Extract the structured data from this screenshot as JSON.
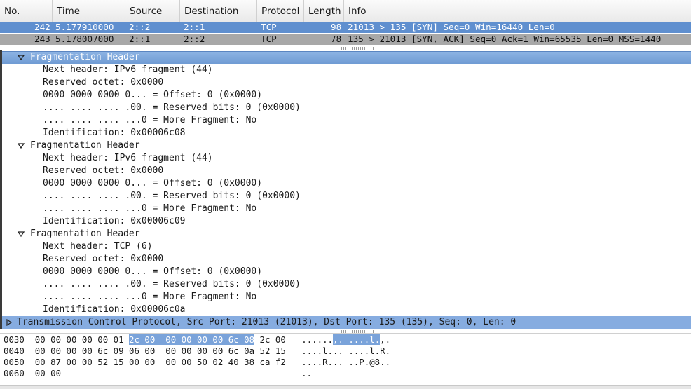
{
  "columns": [
    "No.",
    "Time",
    "Source",
    "Destination",
    "Protocol",
    "Length",
    "Info"
  ],
  "packets": [
    {
      "no": "242",
      "time": "5.177910000",
      "source": "2::2",
      "destination": "2::1",
      "protocol": "TCP",
      "length": "98",
      "info": "21013 > 135 [SYN] Seq=0 Win=16440 Len=0"
    },
    {
      "no": "243",
      "time": "5.178007000",
      "source": "2::1",
      "destination": "2::2",
      "protocol": "TCP",
      "length": "78",
      "info": "135 > 21013 [SYN, ACK] Seq=0 Ack=1 Win=65535 Len=0 MSS=1440"
    }
  ],
  "details": {
    "frag1": {
      "title": "Fragmentation Header",
      "lines": [
        "Next header: IPv6 fragment (44)",
        "Reserved octet: 0x0000",
        "0000 0000 0000 0... = Offset: 0 (0x0000)",
        ".... .... .... .00. = Reserved bits: 0 (0x0000)",
        ".... .... .... ...0 = More Fragment: No",
        "Identification: 0x00006c08"
      ]
    },
    "frag2": {
      "title": "Fragmentation Header",
      "lines": [
        "Next header: IPv6 fragment (44)",
        "Reserved octet: 0x0000",
        "0000 0000 0000 0... = Offset: 0 (0x0000)",
        ".... .... .... .00. = Reserved bits: 0 (0x0000)",
        ".... .... .... ...0 = More Fragment: No",
        "Identification: 0x00006c09"
      ]
    },
    "frag3": {
      "title": "Fragmentation Header",
      "lines": [
        "Next header: TCP (6)",
        "Reserved octet: 0x0000",
        "0000 0000 0000 0... = Offset: 0 (0x0000)",
        ".... .... .... .00. = Reserved bits: 0 (0x0000)",
        ".... .... .... ...0 = More Fragment: No",
        "Identification: 0x00006c0a"
      ]
    },
    "tcp": "Transmission Control Protocol, Src Port: 21013 (21013), Dst Port: 135 (135), Seq: 0, Len: 0"
  },
  "bytes": [
    {
      "offset": "0030",
      "pre": "00 00 00 00 00 01 ",
      "hl": "2c 00  00 00 00 00 6c 08",
      "post": " 2c 00",
      "ascii_pre": "......",
      "ascii_hl": ",. ....l.",
      "ascii_post": ",."
    },
    {
      "offset": "0040",
      "pre": "00 00 00 00 6c 09 06 00  00 00 00 00 6c 0a 52 15",
      "hl": "",
      "post": "",
      "ascii_pre": "....l... ....l.R.",
      "ascii_hl": "",
      "ascii_post": ""
    },
    {
      "offset": "0050",
      "pre": "00 87 00 00 52 15 00 00  00 00 50 02 40 38 ca f2",
      "hl": "",
      "post": "",
      "ascii_pre": "....R... ..P.@8..",
      "ascii_hl": "",
      "ascii_post": ""
    },
    {
      "offset": "0060",
      "pre": "00 00",
      "hl": "",
      "post": "",
      "ascii_pre": "..",
      "ascii_hl": "",
      "ascii_post": ""
    }
  ],
  "colors": {
    "selected_packet": "#5f8fcf",
    "marked_packet": "#a8a8a8",
    "tree_highlight": "#7ea6d8"
  }
}
